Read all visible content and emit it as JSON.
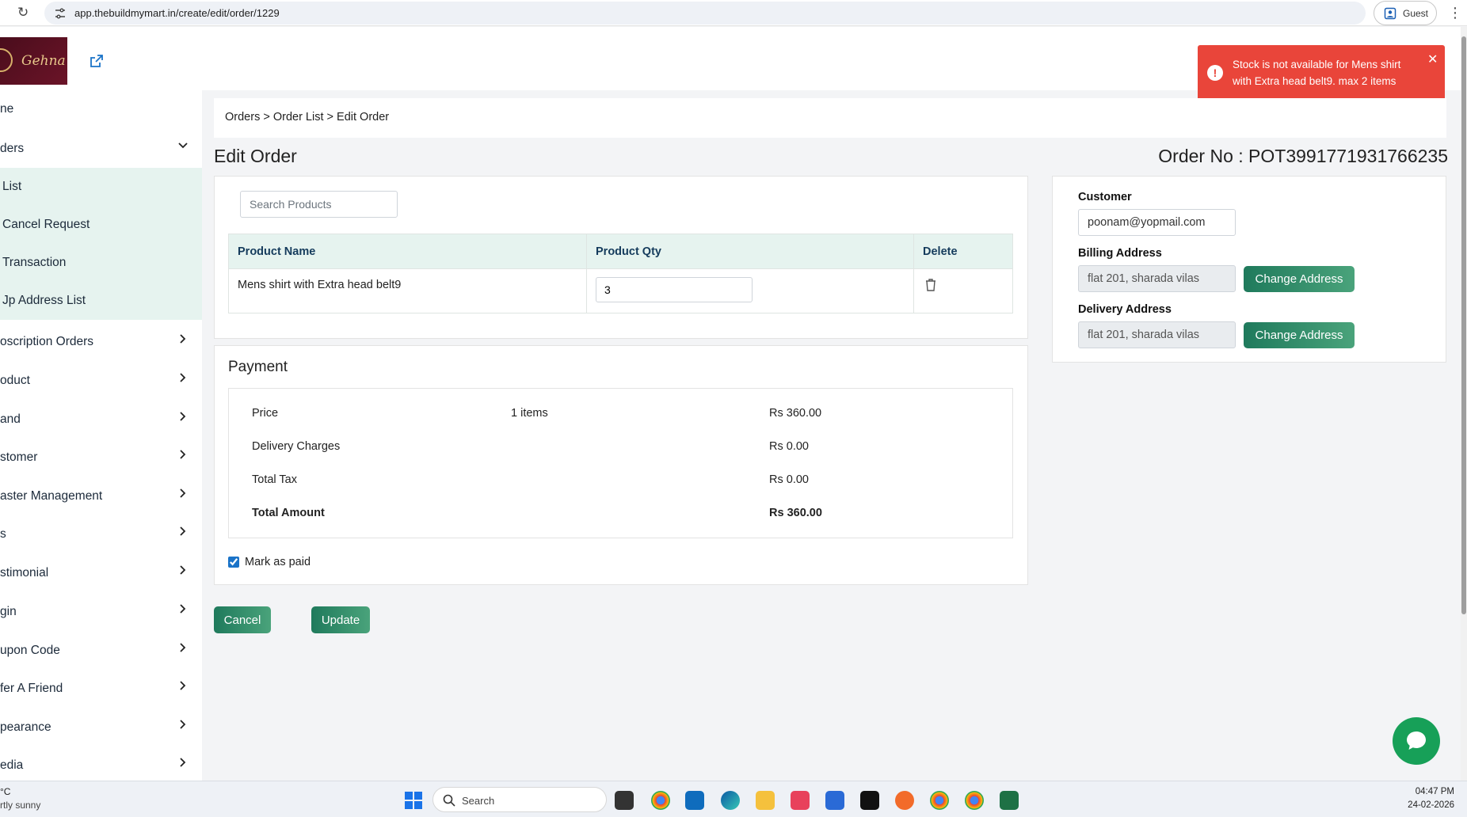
{
  "browser": {
    "url": "app.thebuildmymart.in/create/edit/order/1229",
    "profile_label": "Guest"
  },
  "brand": {
    "logo_text": "Gehna"
  },
  "toast": {
    "message": "Stock is not available for Mens shirt with Extra head belt9. max 2 items",
    "color": "#e9453a"
  },
  "sidebar": {
    "items": [
      {
        "label": "ne"
      },
      {
        "label": "ders"
      },
      {
        "label": "List"
      },
      {
        "label": "Cancel Request"
      },
      {
        "label": "Transaction"
      },
      {
        "label": "Jp Address List"
      },
      {
        "label": "oscription Orders"
      },
      {
        "label": "oduct"
      },
      {
        "label": "and"
      },
      {
        "label": "stomer"
      },
      {
        "label": "aster Management"
      },
      {
        "label": "s"
      },
      {
        "label": "stimonial"
      },
      {
        "label": "gin"
      },
      {
        "label": "upon Code"
      },
      {
        "label": "fer A Friend"
      },
      {
        "label": "pearance"
      },
      {
        "label": "edia"
      }
    ]
  },
  "breadcrumb": "Orders > Order List > Edit Order",
  "page": {
    "title": "Edit Order",
    "order_no": "Order No : POT3991771931766235"
  },
  "products": {
    "search_placeholder": "Search Products",
    "columns": [
      "Product Name",
      "Product Qty",
      "Delete"
    ],
    "rows": [
      {
        "name": "Mens shirt with Extra head belt9",
        "qty": "3"
      }
    ]
  },
  "payment": {
    "title": "Payment",
    "rows": [
      {
        "label": "Price",
        "items": "1 items",
        "amount": "Rs 360.00"
      },
      {
        "label": "Delivery Charges",
        "items": "",
        "amount": "Rs 0.00"
      },
      {
        "label": "Total Tax",
        "items": "",
        "amount": "Rs 0.00"
      },
      {
        "label": "Total Amount",
        "items": "",
        "amount": "Rs 360.00"
      }
    ],
    "mark_paid_label": "Mark as paid",
    "mark_paid_checked": true
  },
  "actions": {
    "cancel": "Cancel",
    "update": "Update"
  },
  "customer": {
    "label": "Customer",
    "email": "poonam@yopmail.com",
    "billing_label": "Billing Address",
    "billing_value": "flat 201, sharada vilas",
    "delivery_label": "Delivery Address",
    "delivery_value": "flat 201, sharada vilas",
    "change_address": "Change Address"
  },
  "taskbar": {
    "weather_temp": "°C",
    "weather_desc": "rtly sunny",
    "search_label": "Search",
    "time": "04:47 PM",
    "date": "24-02-2026"
  },
  "colors": {
    "accent": "#1f7a5c",
    "table_header": "#e6f3ef",
    "chat": "#17a058"
  }
}
